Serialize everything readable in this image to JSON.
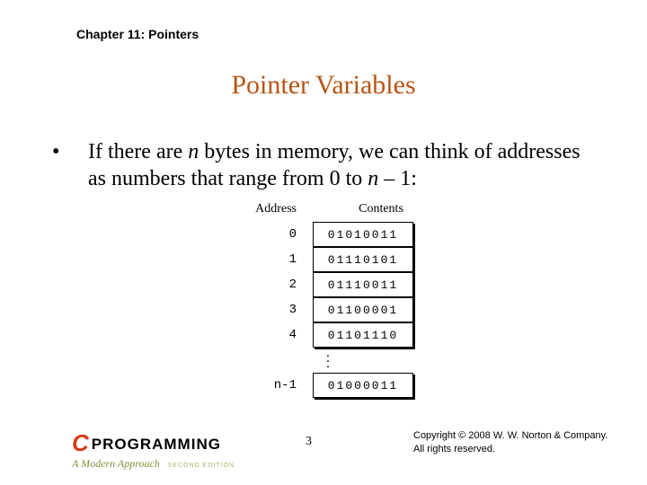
{
  "chapter": "Chapter 11: Pointers",
  "title": "Pointer Variables",
  "bullet": {
    "pre": "If there are ",
    "n1": "n",
    "mid": " bytes in memory, we can think of addresses as numbers that range from 0 to ",
    "n2": "n",
    "post": " – 1:"
  },
  "diagram": {
    "header_addr": "Address",
    "header_cont": "Contents",
    "rows": [
      {
        "addr": "0",
        "cont": "01010011"
      },
      {
        "addr": "1",
        "cont": "01110101"
      },
      {
        "addr": "2",
        "cont": "01110011"
      },
      {
        "addr": "3",
        "cont": "01100001"
      },
      {
        "addr": "4",
        "cont": "01101110"
      }
    ],
    "last": {
      "addr": "n-1",
      "cont": "01000011"
    }
  },
  "footer": {
    "logo_c": "C",
    "logo_rest": "PROGRAMMING",
    "logo_sub": "A Modern Approach",
    "logo_ed": "SECOND EDITION",
    "page": "3",
    "copy1": "Copyright © 2008 W. W. Norton & Company.",
    "copy2": "All rights reserved."
  }
}
